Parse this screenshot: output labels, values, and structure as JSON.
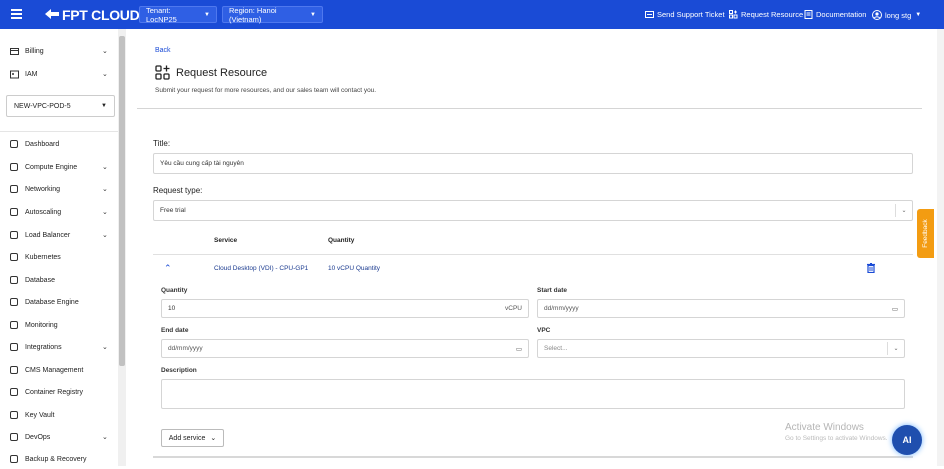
{
  "topbar": {
    "brand": "FPT CLOUD",
    "tenant": "Tenant: LocNP25",
    "region": "Region: Hanoi (Vietnam)",
    "actions": {
      "support": "Send Support Ticket",
      "request": "Request Resource",
      "docs": "Documentation",
      "user": "long stg"
    }
  },
  "sidebar": {
    "billing": "Billing",
    "iam": "IAM",
    "project": "NEW-VPC-POD-5",
    "items": [
      {
        "label": "Dashboard"
      },
      {
        "label": "Compute Engine"
      },
      {
        "label": "Networking"
      },
      {
        "label": "Autoscaling"
      },
      {
        "label": "Load Balancer"
      },
      {
        "label": "Kubernetes"
      },
      {
        "label": "Database"
      },
      {
        "label": "Database Engine"
      },
      {
        "label": "Monitoring"
      },
      {
        "label": "Integrations"
      },
      {
        "label": "CMS Management"
      },
      {
        "label": "Container Registry"
      },
      {
        "label": "Key Vault"
      },
      {
        "label": "DevOps"
      },
      {
        "label": "Backup & Recovery"
      }
    ]
  },
  "page": {
    "back": "Back",
    "title": "Request Resource",
    "subtitle": "Submit your request for more resources, and our sales team will contact you."
  },
  "form": {
    "title_label": "Title:",
    "title_value": "Yêu cầu cung cấp tài nguyên",
    "type_label": "Request type:",
    "type_value": "Free trial",
    "table": {
      "col_service": "Service",
      "col_quantity": "Quantity",
      "row_service": "Cloud Desktop (VDI) - CPU-GP1",
      "row_quantity": "10 vCPU Quantity"
    },
    "quantity_label": "Quantity",
    "quantity_value": "10",
    "quantity_unit": "vCPU",
    "start_label": "Start date",
    "start_placeholder": "dd/mm/yyyy",
    "end_label": "End date",
    "end_placeholder": "dd/mm/yyyy",
    "vpc_label": "VPC",
    "vpc_placeholder": "Select...",
    "desc_label": "Description",
    "add_service": "Add service"
  },
  "feedback": "Feedback",
  "watermark": {
    "line1": "Activate Windows",
    "line2": "Go to Settings to activate Windows."
  },
  "ai_button": "AI"
}
